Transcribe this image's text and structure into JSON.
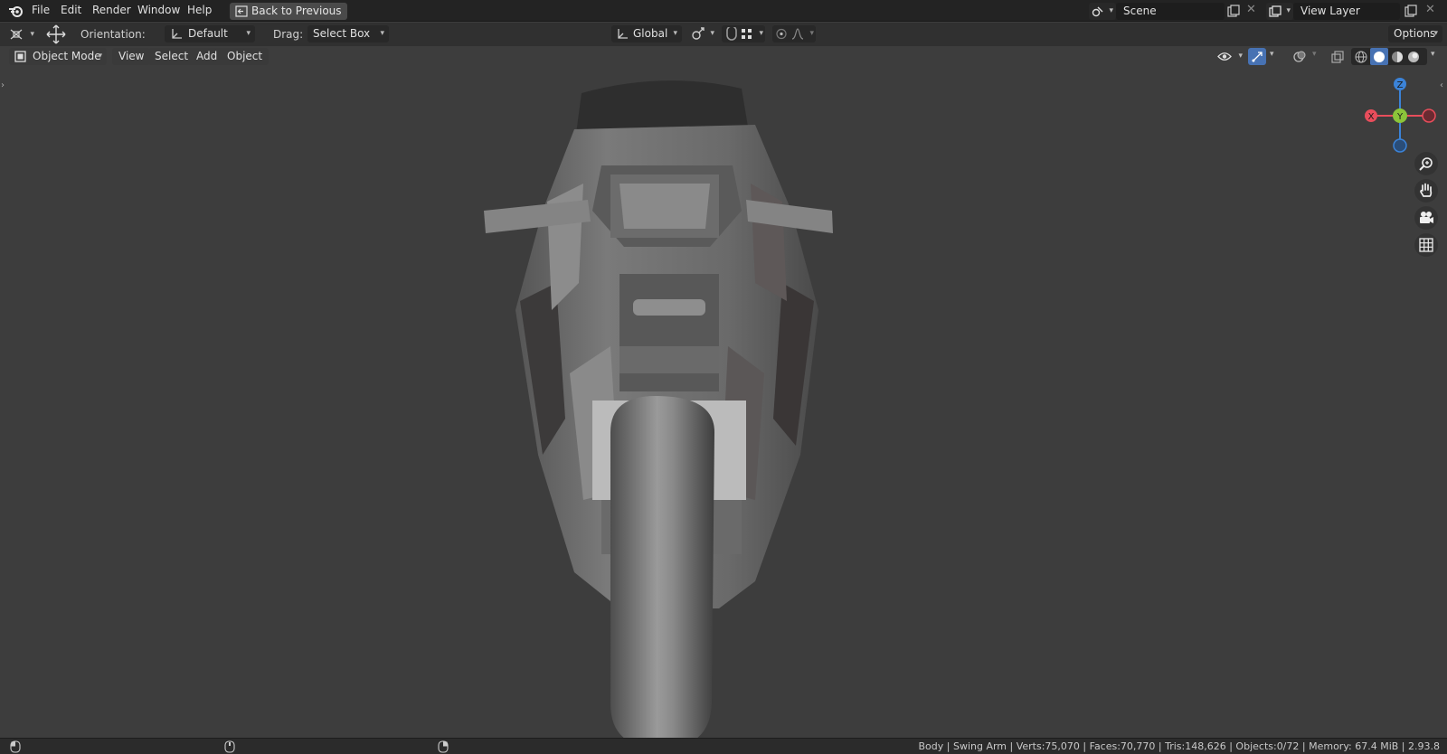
{
  "topbar": {
    "menus": [
      "File",
      "Edit",
      "Render",
      "Window",
      "Help"
    ],
    "back_button": "Back to Previous",
    "scene_field": "Scene",
    "view_layer_field": "View Layer"
  },
  "tool_header": {
    "orientation_label": "Orientation:",
    "orientation_value": "Default",
    "drag_label": "Drag:",
    "drag_value": "Select Box",
    "transform_orientation": "Global",
    "options_label": "Options"
  },
  "viewport_header": {
    "mode": "Object Mode",
    "menus": [
      "View",
      "Select",
      "Add",
      "Object"
    ]
  },
  "gizmo": {
    "z": "Z",
    "y": "Y",
    "x": "X",
    "colors": {
      "x": "#e84d5b",
      "y": "#8bc43a",
      "z": "#3b83d8"
    }
  },
  "navigation_icons": [
    "zoom-icon",
    "hand-pan-icon",
    "camera-icon",
    "grid-icon"
  ],
  "statusbar": {
    "text": "Body | Swing Arm | Verts:75,070 | Faces:70,770 | Tris:148,626 | Objects:0/72 | Memory: 67.4 MiB | 2.93.8"
  }
}
